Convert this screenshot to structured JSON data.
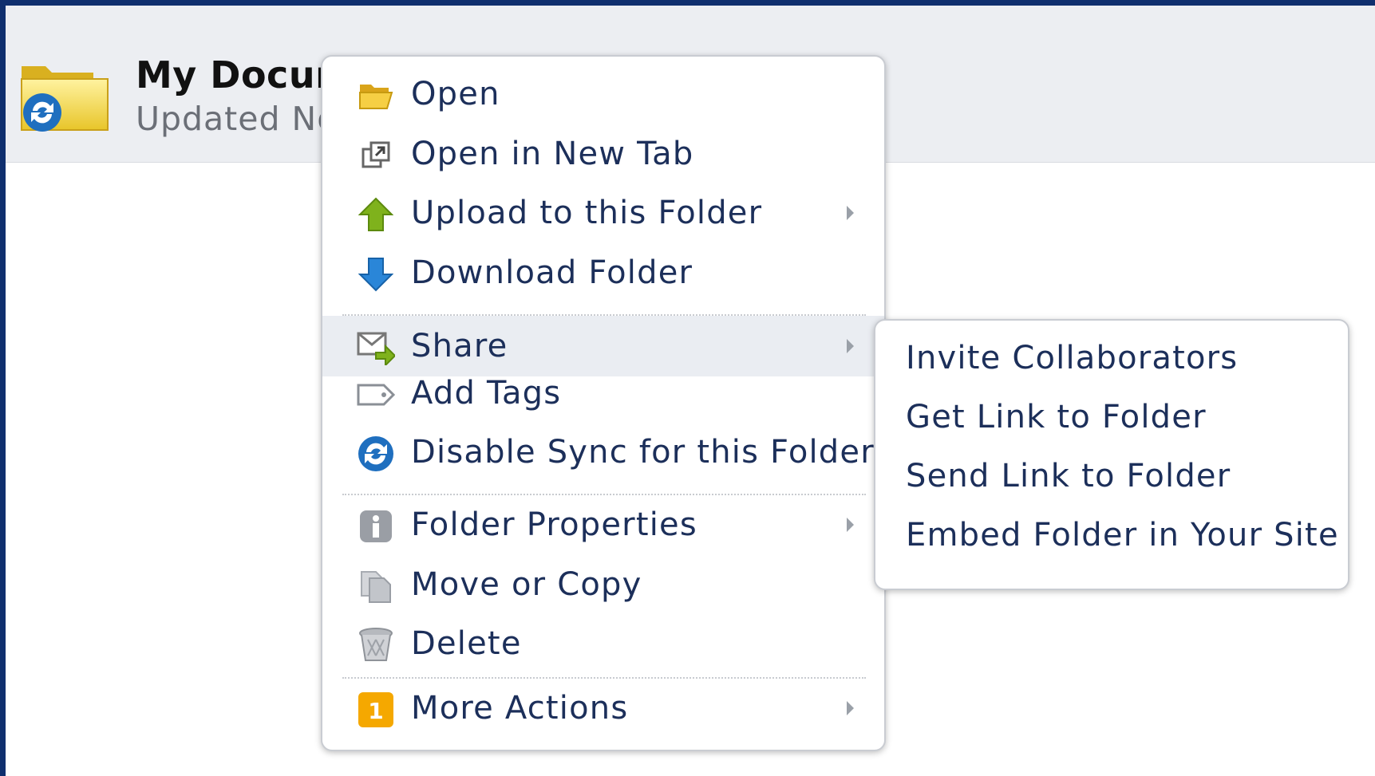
{
  "folder": {
    "name": "My Documents",
    "updated": "Updated Now",
    "icon": "folder-sync-icon"
  },
  "context_menu": {
    "items": [
      {
        "label": "Open",
        "icon": "open-folder-icon",
        "has_submenu": false
      },
      {
        "label": "Open in New Tab",
        "icon": "new-tab-icon",
        "has_submenu": false
      },
      {
        "label": "Upload to this Folder",
        "icon": "upload-arrow-icon",
        "has_submenu": true
      },
      {
        "label": "Download Folder",
        "icon": "download-arrow-icon",
        "has_submenu": false
      },
      {
        "label": "Share",
        "icon": "share-mail-icon",
        "has_submenu": true,
        "active": true
      },
      {
        "label": "Add Tags",
        "icon": "tag-icon",
        "has_submenu": false
      },
      {
        "label": "Disable Sync for this Folder",
        "icon": "sync-icon",
        "has_submenu": false
      },
      {
        "label": "Folder Properties",
        "icon": "info-icon",
        "has_submenu": true
      },
      {
        "label": "Move or Copy",
        "icon": "copy-icon",
        "has_submenu": false
      },
      {
        "label": "Delete",
        "icon": "trash-icon",
        "has_submenu": false
      },
      {
        "label": "More Actions",
        "icon": "more-actions-badge-icon",
        "badge": "1",
        "has_submenu": true
      }
    ]
  },
  "share_submenu": {
    "items": [
      {
        "label": "Invite Collaborators"
      },
      {
        "label": "Get Link to Folder"
      },
      {
        "label": "Send Link to Folder"
      },
      {
        "label": "Embed Folder in Your Site"
      }
    ]
  },
  "colors": {
    "frame_border": "#0f2f6e",
    "menu_text": "#1c2f5a",
    "active_row": "#eaedf2",
    "badge": "#f5a800"
  }
}
